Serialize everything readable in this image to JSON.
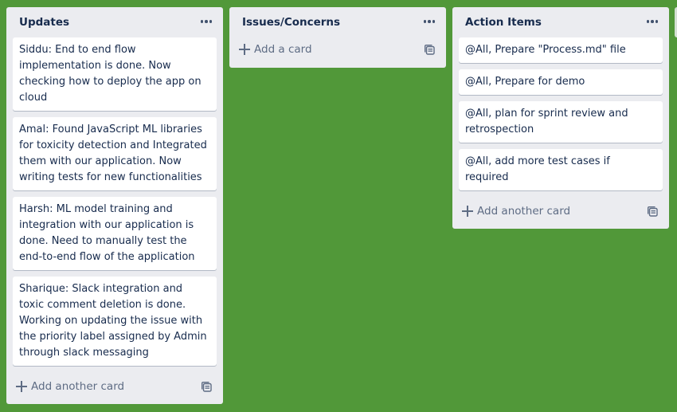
{
  "lists": [
    {
      "title": "Updates",
      "cards": [
        "Siddu: End to end flow implementation is done. Now checking how to deploy the app on cloud",
        "Amal: Found JavaScript ML libraries for toxicity detection and Integrated them with our application. Now writing tests for new functionalities",
        "Harsh: ML model training and integration with our application is done. Need to manually test the end-to-end flow of the application",
        "Sharique: Slack integration and toxic comment deletion is done. Working on updating the issue with the priority label assigned by Admin through slack messaging"
      ],
      "add_label": "Add another card"
    },
    {
      "title": "Issues/Concerns",
      "cards": [],
      "add_label": "Add a card"
    },
    {
      "title": "Action Items",
      "cards": [
        "@All, Prepare \"Process.md\" file",
        "@All, Prepare for demo",
        "@All, plan for sprint review and retrospection",
        "@All, add more test cases if required"
      ],
      "add_label": "Add another card"
    }
  ],
  "icons": {
    "menu": "more-horizontal-icon",
    "add": "plus-icon",
    "template": "card-template-icon"
  },
  "colors": {
    "board_background": "#519839",
    "list_background": "#ebecf0",
    "card_background": "#ffffff"
  }
}
